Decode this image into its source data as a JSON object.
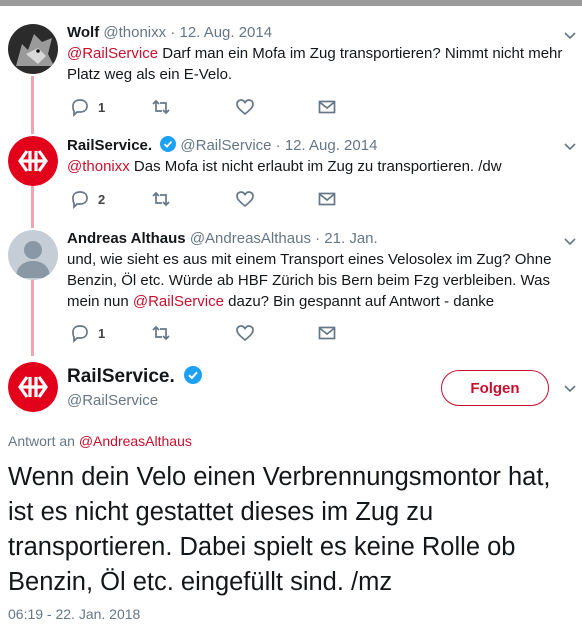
{
  "tweets": [
    {
      "name": "Wolf",
      "handle": "@thonixx",
      "date": "12. Aug. 2014",
      "mention": "@RailService",
      "text": " Darf man ein Mofa im Zug transportieren? Nimmt nicht mehr Platz weg als ein E-Velo.",
      "reply_count": "1",
      "avatar_icon": "wolf-avatar"
    },
    {
      "name": "RailService.",
      "handle": "@RailService",
      "date": "12. Aug. 2014",
      "mention": "@thonixx",
      "text": " Das Mofa ist nicht erlaubt im Zug zu transportieren. /dw",
      "reply_count": "2",
      "avatar_icon": "sbb-logo-avatar"
    },
    {
      "name": "Andreas Althaus",
      "handle": "@AndreasAlthaus",
      "date": "21. Jan.",
      "text_before": "und, wie sieht es aus mit einem Transport eines Velosolex im Zug? Ohne Benzin, Öl etc. Würde ab HBF Zürich bis Bern beim Fzg verbleiben. Was mein nun ",
      "mention": "@RailService",
      "text_after": " dazu? Bin gespannt auf Antwort - danke",
      "reply_count": "1",
      "avatar_icon": "default-avatar"
    }
  ],
  "main_tweet": {
    "name": "RailService.",
    "handle": "@RailService",
    "follow_label": "Folgen",
    "reply_prefix": "Antwort an",
    "reply_to": "@AndreasAlthaus",
    "text": "Wenn dein Velo einen Verbrennungsmontor hat, ist es nicht gestattet dieses im Zug zu transportieren. Dabei spielt es keine Rolle ob Benzin, Öl etc. eingefüllt sind. /mz",
    "timestamp": "06:19 - 22. Jan. 2018"
  },
  "colors": {
    "accent": "#c8102e",
    "thread_line": "#f0a4b0",
    "muted": "#657786",
    "verified": "#1da1f2"
  }
}
